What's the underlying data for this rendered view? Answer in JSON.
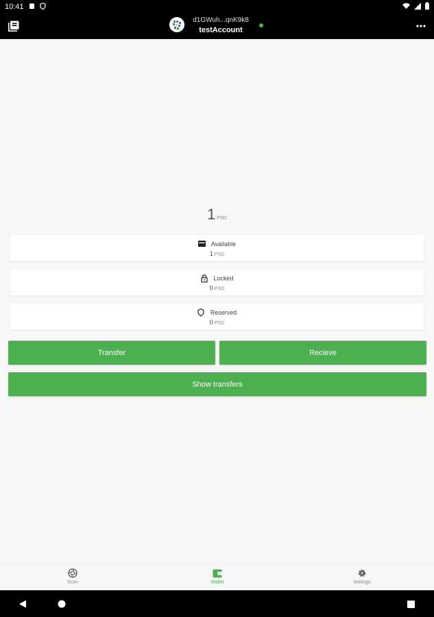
{
  "status_bar": {
    "time": "10:41",
    "icons": [
      "notification-icon",
      "shield-icon",
      "wifi-icon",
      "signal-icon",
      "battery-icon"
    ]
  },
  "header": {
    "address": "d1GWuh...qnK9k8",
    "account_name": "testAccount",
    "status": "online",
    "status_color": "#4caf50",
    "menu_icon": "library-icon",
    "more_icon": "more-icon"
  },
  "balance": {
    "total": "1",
    "unit": "PSD"
  },
  "cards": [
    {
      "icon": "wallet-icon",
      "label": "Available",
      "value": "1",
      "unit": "PSD"
    },
    {
      "icon": "lock-icon",
      "label": "Locked",
      "value": "0",
      "unit": "PSD"
    },
    {
      "icon": "shield-icon",
      "label": "Reserved",
      "value": "0",
      "unit": "PSD"
    }
  ],
  "buttons": {
    "transfer": "Transfer",
    "receive": "Recieve",
    "show_transfers": "Show transfers"
  },
  "colors": {
    "accent": "#4caf50",
    "background": "#f7f7f7",
    "bar": "#000000"
  },
  "bottom_nav": [
    {
      "icon": "aperture-icon",
      "label": "Scan",
      "active": false
    },
    {
      "icon": "wallet-icon",
      "label": "Wallet",
      "active": true
    },
    {
      "icon": "gear-icon",
      "label": "Settings",
      "active": false
    }
  ],
  "system_nav": [
    "back-icon",
    "home-icon",
    "recents-icon"
  ]
}
